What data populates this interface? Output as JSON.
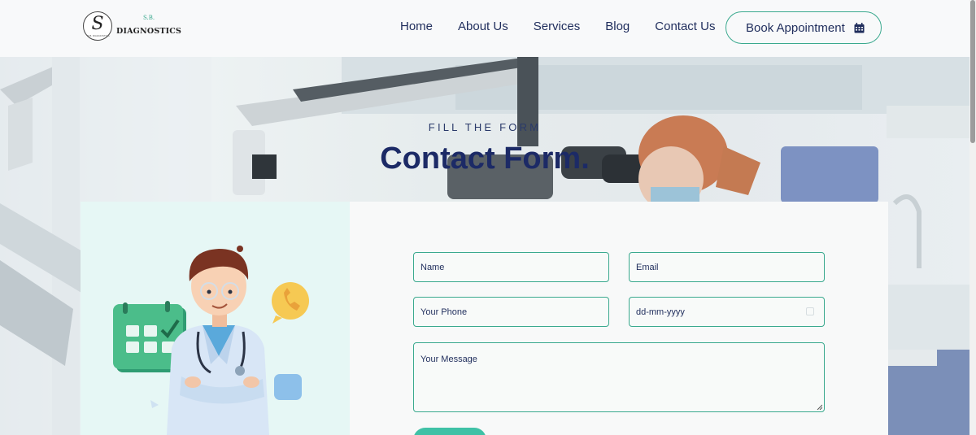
{
  "brand": {
    "mark": "S",
    "mark_small": "S.B. DIAGNOSTICS",
    "abbr": "S.B.",
    "name": "DIAGNOSTICS"
  },
  "nav": {
    "items": [
      "Home",
      "About Us",
      "Services",
      "Blog",
      "Contact Us"
    ]
  },
  "cta": {
    "label": "Book Appointment",
    "icon": "calendar-icon"
  },
  "hero": {
    "subtitle": "FILL THE FORM",
    "title": "Contact Form."
  },
  "form": {
    "name_placeholder": "Name",
    "email_placeholder": "Email",
    "phone_placeholder": "Your Phone",
    "date_placeholder": "dd-mm-yyyy",
    "message_placeholder": "Your Message"
  },
  "colors": {
    "accent": "#3aa98e",
    "navy": "#1c2a66",
    "panel": "#e6f7f5",
    "button": "#3fc1a6"
  }
}
